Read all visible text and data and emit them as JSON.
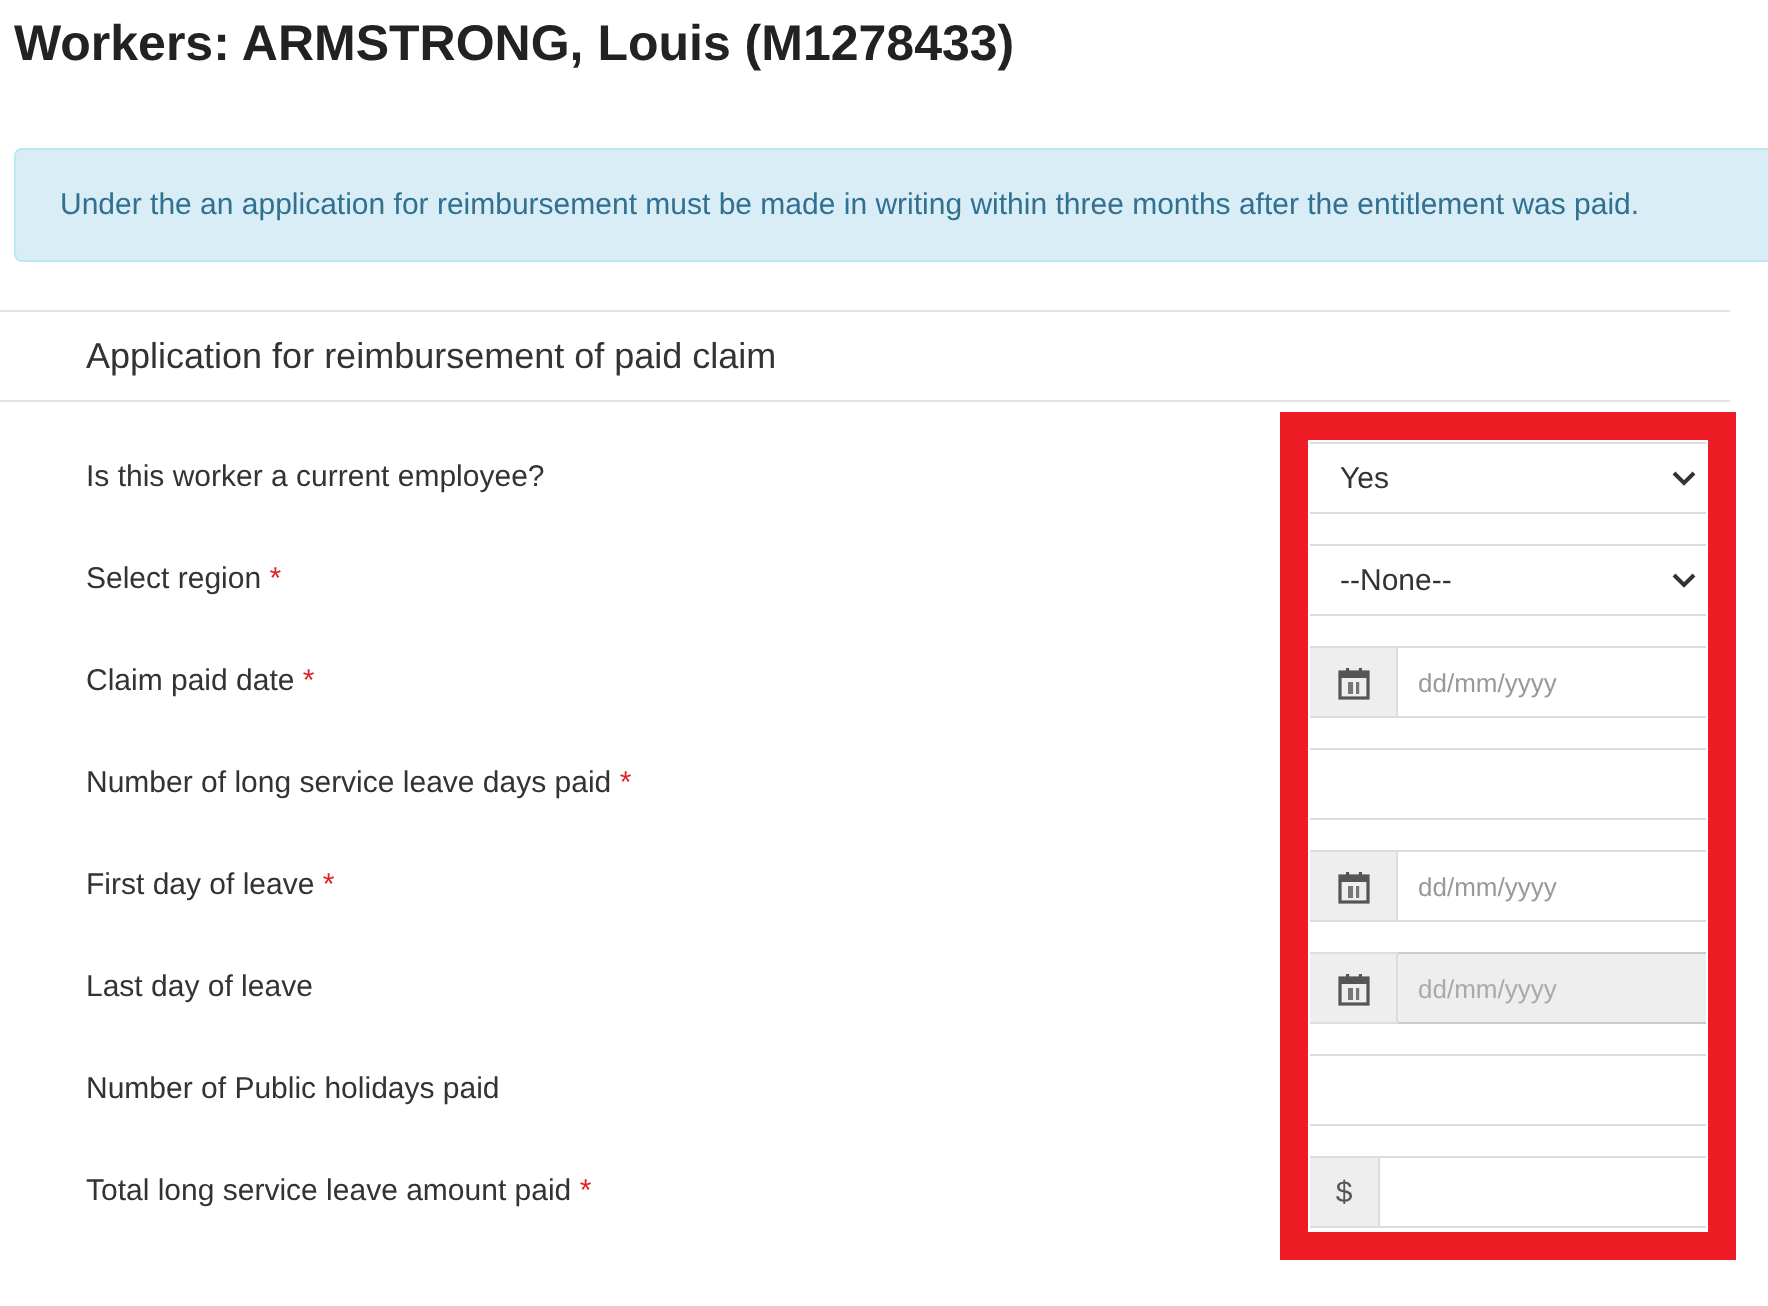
{
  "title": "Workers: ARMSTRONG, Louis (M1278433)",
  "alert": "Under the an application for reimbursement must be made in writing within three months after the entitlement was paid.",
  "section": {
    "title": "Application for reimbursement of paid claim"
  },
  "fields": [
    {
      "label": "Is this worker a current employee?",
      "required": false,
      "kind": "select",
      "value": "Yes",
      "disabled": false
    },
    {
      "label": "Select region",
      "required": true,
      "kind": "select",
      "value": "--None--",
      "disabled": false
    },
    {
      "label": "Claim paid date",
      "required": true,
      "kind": "date",
      "placeholder": "dd/mm/yyyy",
      "disabled": false
    },
    {
      "label": "Number of long service leave days paid",
      "required": true,
      "kind": "text",
      "disabled": false
    },
    {
      "label": "First day of leave",
      "required": true,
      "kind": "date",
      "placeholder": "dd/mm/yyyy",
      "disabled": false
    },
    {
      "label": "Last day of leave",
      "required": false,
      "kind": "date",
      "placeholder": "dd/mm/yyyy",
      "disabled": true
    },
    {
      "label": "Number of Public holidays paid",
      "required": false,
      "kind": "text",
      "disabled": false
    },
    {
      "label": "Total long service leave amount paid",
      "required": true,
      "kind": "currency",
      "addon": "$",
      "disabled": false
    }
  ],
  "required_mark": "*"
}
